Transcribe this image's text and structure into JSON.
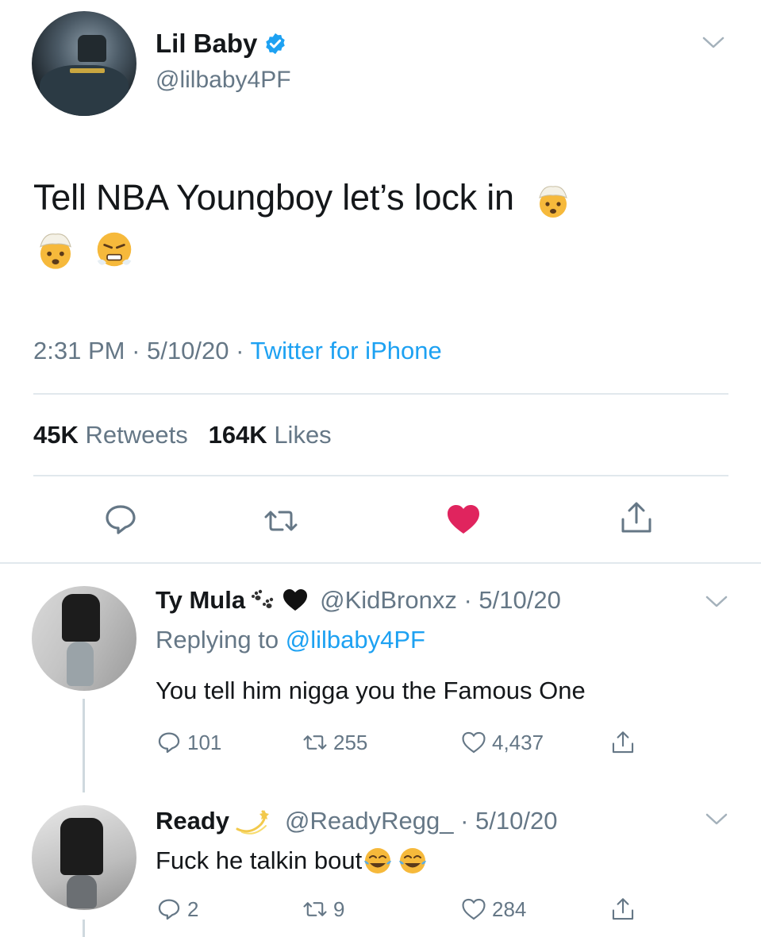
{
  "main_tweet": {
    "author_name": "Lil Baby",
    "handle": "@lilbaby4PF",
    "text": "Tell  NBA Youngboy let’s lock in",
    "time": "2:31 PM",
    "sep1": "·",
    "date": "5/10/20",
    "sep2": "·",
    "source": "Twitter for iPhone",
    "retweets_count": "45K",
    "retweets_label": "Retweets",
    "likes_count": "164K",
    "likes_label": "Likes",
    "liked": true,
    "accent_color": "#1da1f2",
    "like_color": "#e0245e"
  },
  "replies": [
    {
      "name": "Ty Mula",
      "handle_date": "@KidBronxz · 5/10/20",
      "replying_prefix": "Replying to",
      "replying_to": "@lilbaby4PF",
      "text": "You tell him nigga you the Famous One",
      "replies": "101",
      "retweets": "255",
      "likes": "4,437"
    },
    {
      "name": "Ready",
      "handle_date": "@ReadyRegg_ · 5/10/20",
      "text": "Fuck he talkin bout",
      "replies": "2",
      "retweets": "9",
      "likes": "284"
    }
  ]
}
